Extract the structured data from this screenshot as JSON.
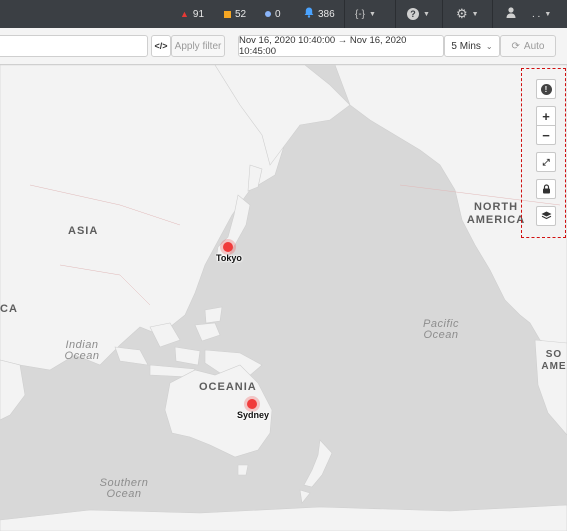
{
  "topbar": {
    "alerts": [
      {
        "icon": "triangle-alert-icon",
        "count": "91",
        "color": "#e53935"
      },
      {
        "icon": "square-warning-icon",
        "count": "52",
        "color": "#f5a623"
      },
      {
        "icon": "circle-info-icon",
        "count": "0",
        "color": "#8ab4f8"
      },
      {
        "icon": "bell-icon",
        "count": "386",
        "color": "#4aa3ff"
      }
    ],
    "code_menu_label": "{-}",
    "help_icon": "question-icon",
    "settings_icon": "gear-icon",
    "user_icon": "user-icon",
    "user_label": ". ."
  },
  "filterbar": {
    "query_toggle_label": "</>",
    "apply_filter_label": "Apply filter",
    "time_range": "Nov 16, 2020 10:40:00 → Nov 16, 2020 10:45:00",
    "interval": "5 Mins",
    "auto_label": "Auto"
  },
  "map": {
    "region_labels": {
      "asia": "ASIA",
      "north_america": "NORTH AMERICA",
      "oceania": "OCEANIA",
      "left_edge": "CA",
      "right_edge": "SO AME"
    },
    "ocean_labels": {
      "indian": "Indian Ocean",
      "pacific": "Pacific Ocean",
      "southern": "Southern Ocean"
    },
    "markers": [
      {
        "city": "Tokyo",
        "color": "#f03c3c"
      },
      {
        "city": "Sydney",
        "color": "#f03c3c"
      }
    ],
    "controls": [
      "info-icon",
      "zoom-in-icon",
      "zoom-out-icon",
      "fullscreen-icon",
      "lock-icon",
      "layers-icon"
    ],
    "land_color": "#f3f3f3",
    "water_color": "#d8d8d8"
  }
}
